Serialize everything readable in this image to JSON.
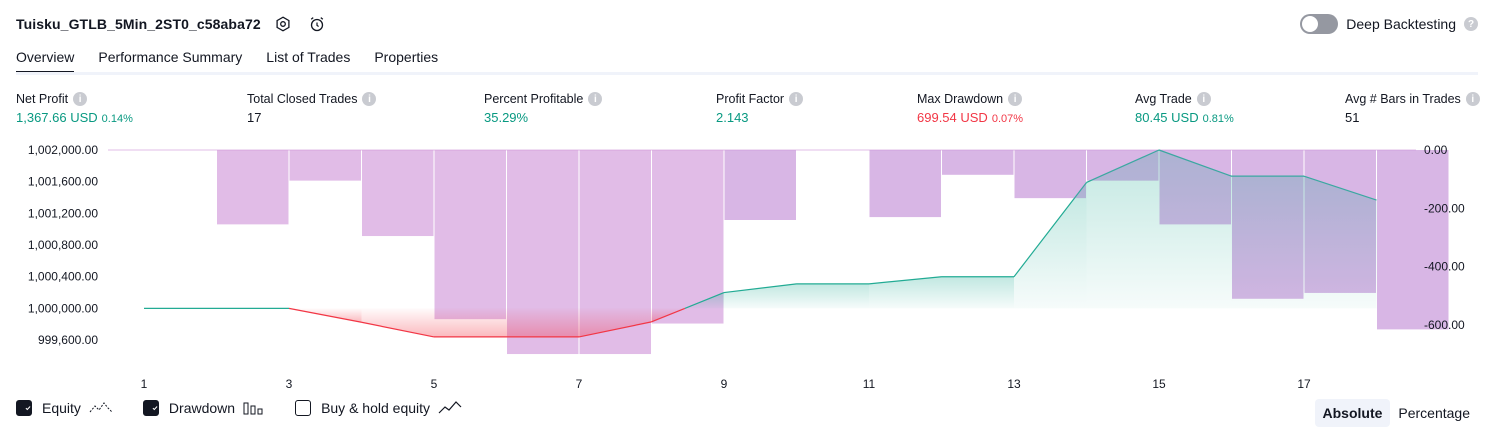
{
  "header": {
    "title": "Tuisku_GTLB_5Min_2ST0_c58aba72",
    "deep_backtesting_label": "Deep Backtesting",
    "help_glyph": "?"
  },
  "tabs": [
    {
      "label": "Overview",
      "active": true
    },
    {
      "label": "Performance Summary",
      "active": false
    },
    {
      "label": "List of Trades",
      "active": false
    },
    {
      "label": "Properties",
      "active": false
    }
  ],
  "metrics": [
    {
      "label": "Net Profit",
      "value": "1,367.66 USD",
      "pct": "0.14%",
      "tone": "pos"
    },
    {
      "label": "Total Closed Trades",
      "value": "17",
      "pct": "",
      "tone": "plain"
    },
    {
      "label": "Percent Profitable",
      "value": "35.29%",
      "pct": "",
      "tone": "pos"
    },
    {
      "label": "Profit Factor",
      "value": "2.143",
      "pct": "",
      "tone": "pos"
    },
    {
      "label": "Max Drawdown",
      "value": "699.54 USD",
      "pct": "0.07%",
      "tone": "neg"
    },
    {
      "label": "Avg Trade",
      "value": "80.45 USD",
      "pct": "0.81%",
      "tone": "pos"
    },
    {
      "label": "Avg # Bars in Trades",
      "value": "51",
      "pct": "",
      "tone": "plain"
    }
  ],
  "chart_data": {
    "type": "line",
    "title": "",
    "x_ticks": [
      "1",
      "3",
      "5",
      "7",
      "9",
      "11",
      "13",
      "15",
      "17"
    ],
    "y_left": {
      "ticks": [
        "1,002,000.00",
        "1,001,600.00",
        "1,001,200.00",
        "1,000,800.00",
        "1,000,400.00",
        "1,000,000.00",
        "999,600.00"
      ],
      "range": [
        999500,
        1002000
      ]
    },
    "y_right": {
      "ticks": [
        "0.00",
        "-200.00",
        "-400.00",
        "-600.00"
      ],
      "range": [
        -720,
        0
      ]
    },
    "baseline": 1000000,
    "series": [
      {
        "name": "Equity",
        "x": [
          1,
          2,
          3,
          4,
          5,
          6,
          7,
          8,
          9,
          10,
          11,
          12,
          13,
          14,
          15,
          16,
          17,
          18
        ],
        "values": [
          1000000,
          1000000,
          1000000,
          999825,
          999640,
          999640,
          999640,
          999830,
          1000200,
          1000310,
          1000310,
          1000400,
          1000400,
          1001590,
          1002000,
          1001670,
          1001670,
          1001367.66
        ]
      },
      {
        "name": "Drawdown",
        "x": [
          1,
          2,
          3,
          4,
          5,
          6,
          7,
          8,
          9,
          10,
          11,
          12,
          13,
          14,
          15,
          16,
          17,
          18
        ],
        "values": [
          0,
          -255,
          -105,
          -295,
          -580,
          -699.54,
          -699.54,
          -595,
          -240,
          0,
          -230,
          -85,
          -165,
          -105,
          -255,
          -510,
          -490,
          -615
        ]
      }
    ],
    "colors": {
      "equity_up": "#22ab94",
      "equity_down": "#f23645",
      "drawdown": "#ce93d8"
    }
  },
  "legend": {
    "equity_label": "Equity",
    "drawdown_label": "Drawdown",
    "buyhold_label": "Buy & hold equity",
    "equity_checked": true,
    "drawdown_checked": true,
    "buyhold_checked": false
  },
  "mode": {
    "absolute_label": "Absolute",
    "percentage_label": "Percentage",
    "selected": "Absolute"
  }
}
